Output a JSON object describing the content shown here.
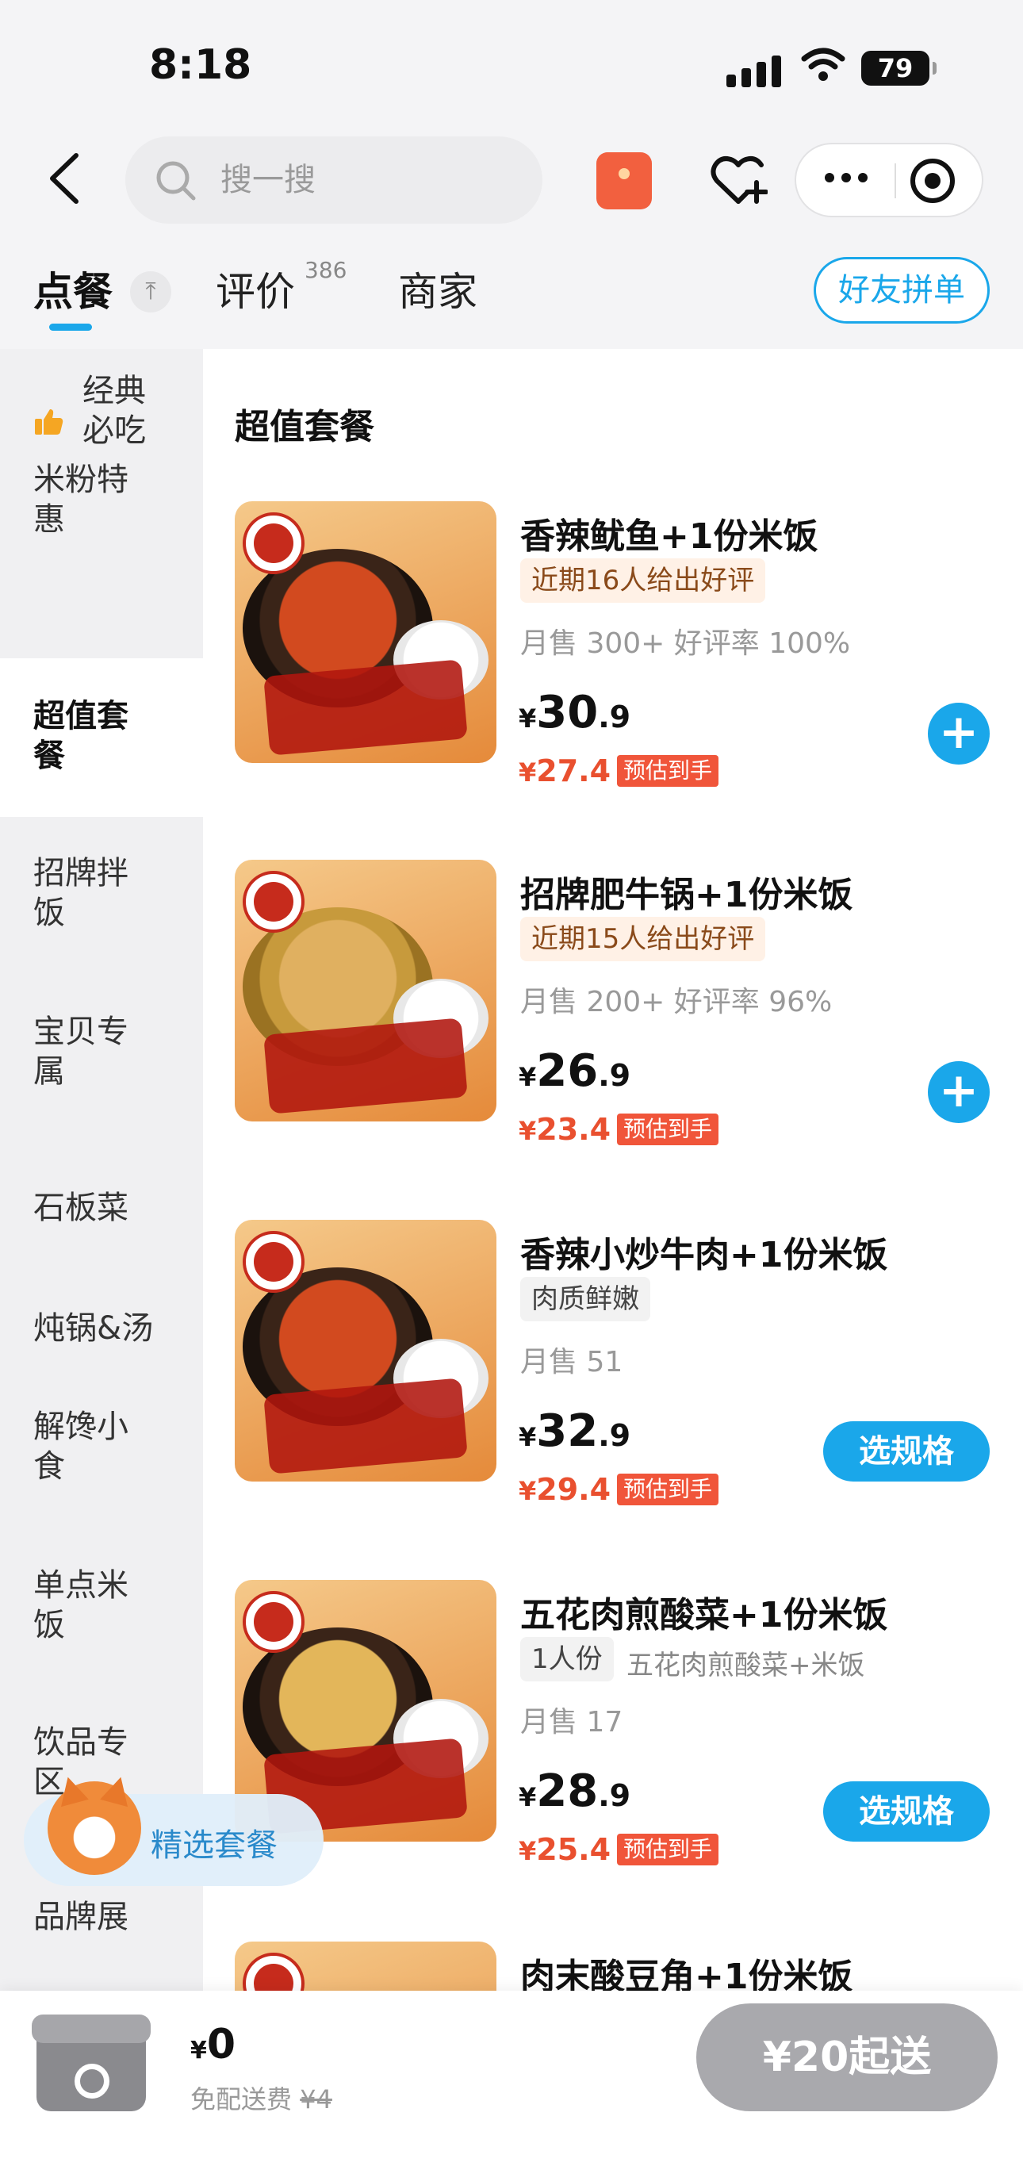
{
  "status_bar": {
    "time": "8:18",
    "battery": "79"
  },
  "search": {
    "placeholder": "搜一搜"
  },
  "tabs": {
    "order": "点餐",
    "reviews": "评价",
    "reviews_count": "386",
    "shop": "商家",
    "group_order": "好友拼单"
  },
  "sidebar": {
    "items": [
      {
        "label": "经典\n必吃",
        "icon": "thumbs-up-icon"
      },
      {
        "label": "米粉特\n惠"
      },
      {
        "label": "超值套\n餐",
        "active": true
      },
      {
        "label": "招牌拌\n饭"
      },
      {
        "label": "宝贝专\n属"
      },
      {
        "label": "石板菜"
      },
      {
        "label": "炖锅&汤"
      },
      {
        "label": "解馋小\n食"
      },
      {
        "label": "单点米\n饭"
      },
      {
        "label": "饮品专\n区"
      },
      {
        "label": "品牌展"
      }
    ]
  },
  "section_title": "超值套餐",
  "products": [
    {
      "name": "香辣鱿鱼+1份米饭",
      "tag": "近期16人给出好评",
      "sales": "月售 300+ 好评率 100%",
      "price_currency": "¥",
      "price_int": "30",
      "price_dec": ".9",
      "est_currency": "¥",
      "est_price": "27.4",
      "est_label": "预估到手",
      "action": "+"
    },
    {
      "name": "招牌肥牛锅+1份米饭",
      "tag": "近期15人给出好评",
      "sales": "月售 200+ 好评率 96%",
      "price_currency": "¥",
      "price_int": "26",
      "price_dec": ".9",
      "est_currency": "¥",
      "est_price": "23.4",
      "est_label": "预估到手",
      "action": "+"
    },
    {
      "name": "香辣小炒牛肉+1份米饭",
      "tag": "肉质鲜嫩",
      "sales": "月售 51",
      "price_currency": "¥",
      "price_int": "32",
      "price_dec": ".9",
      "est_currency": "¥",
      "est_price": "29.4",
      "est_label": "预估到手",
      "action": "选规格"
    },
    {
      "name": "五花肉煎酸菜+1份米饭",
      "tag": "1人份",
      "tag_extra": "五花肉煎酸菜+米饭",
      "sales": "月售 17",
      "price_currency": "¥",
      "price_int": "28",
      "price_dec": ".9",
      "est_currency": "¥",
      "est_price": "25.4",
      "est_label": "预估到手",
      "action": "选规格"
    },
    {
      "name": "肉末酸豆角+1份米饭"
    }
  ],
  "floating": {
    "label": "精选套餐"
  },
  "bottom_bar": {
    "currency": "¥",
    "total": "0",
    "delivery_label": "免配送费",
    "delivery_original": "¥4",
    "min_order": "¥20起送"
  },
  "colors": {
    "accent": "#1aa7ea",
    "price_red": "#e9502f",
    "disabled": "#a9a9ad"
  }
}
